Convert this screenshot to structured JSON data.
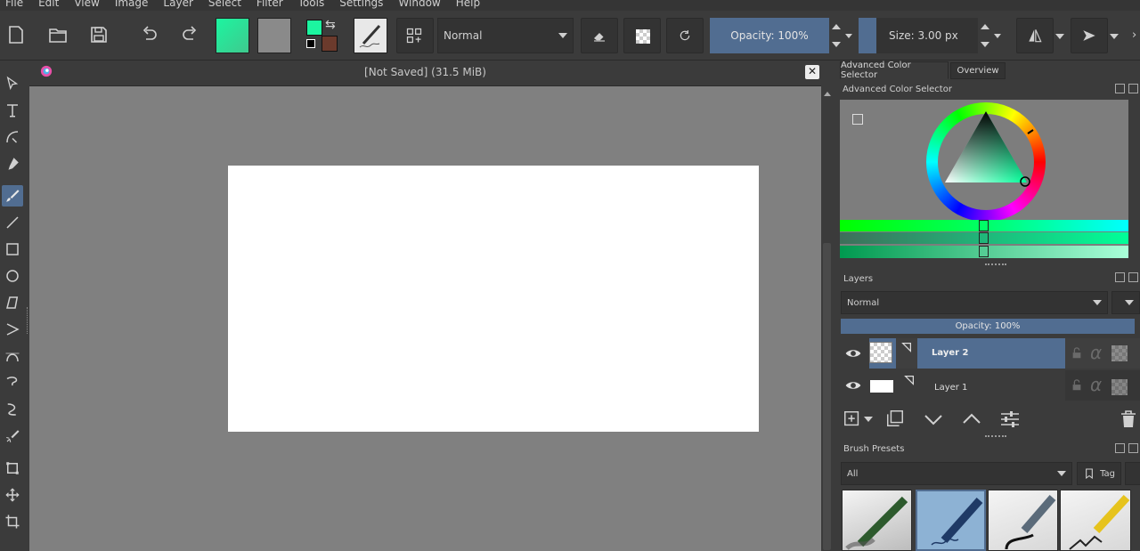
{
  "menu": [
    "File",
    "Edit",
    "View",
    "Image",
    "Layer",
    "Select",
    "Filter",
    "Tools",
    "Settings",
    "Window",
    "Help"
  ],
  "toolbar": {
    "blend_mode": "Normal",
    "opacity_label": "Opacity:  100%",
    "size_label": "Size:  3.00 px",
    "foreground_color": "#1cf5a0",
    "background_color": "#6b3a2c"
  },
  "document": {
    "title": "[Not Saved]  (31.5 MiB)"
  },
  "dockers": {
    "tabs": [
      "Advanced Color Selector",
      "Overview"
    ],
    "color_selector_title": "Advanced Color Selector",
    "layers_title": "Layers",
    "layers_blend_mode": "Normal",
    "layers_opacity": "Opacity:  100%",
    "layers": [
      {
        "name": "Layer 2",
        "selected": true
      },
      {
        "name": "Layer 1",
        "selected": false
      }
    ],
    "brush_presets_title": "Brush Presets",
    "brush_filter": "All",
    "tag_label": "Tag",
    "accent_color": "#516d91"
  }
}
